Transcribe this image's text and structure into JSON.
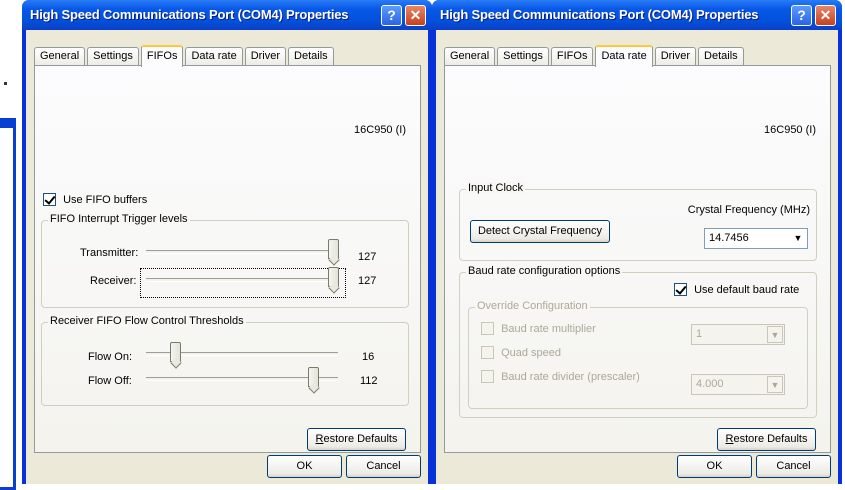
{
  "left_window": {
    "title": "High Speed Communications Port (COM4) Properties",
    "tabs": [
      "General",
      "Settings",
      "FIFOs",
      "Data rate",
      "Driver",
      "Details"
    ],
    "active_tab": "FIFOs",
    "chip": "16C950 (I)",
    "use_fifo_label": "Use FIFO buffers",
    "use_fifo_checked": true,
    "trigger_group": {
      "title": "FIFO Interrupt Trigger levels",
      "transmitter_label": "Transmitter:",
      "transmitter_value": "127",
      "receiver_label": "Receiver:",
      "receiver_value": "127"
    },
    "flow_group": {
      "title": "Receiver FIFO Flow Control Thresholds",
      "flow_on_label": "Flow On:",
      "flow_on_value": "16",
      "flow_off_label": "Flow Off:",
      "flow_off_value": "112"
    },
    "restore_prefix": "R",
    "restore_rest": "estore Defaults",
    "ok_label": "OK",
    "cancel_label": "Cancel"
  },
  "right_window": {
    "title": "High Speed Communications Port (COM4) Properties",
    "tabs": [
      "General",
      "Settings",
      "FIFOs",
      "Data rate",
      "Driver",
      "Details"
    ],
    "active_tab": "Data rate",
    "chip": "16C950 (I)",
    "input_clock": {
      "title": "Input Clock",
      "crystal_label": "Crystal Frequency (MHz)",
      "detect_button": "Detect Crystal Frequency",
      "crystal_value": "14.7456"
    },
    "baud": {
      "title": "Baud rate configuration options",
      "use_default_label": "Use default baud rate",
      "use_default_checked": true,
      "override_title": "Override Configuration",
      "multiplier_label": "Baud rate multiplier",
      "multiplier_value": "1",
      "quad_label": "Quad speed",
      "divider_label": "Baud rate divider (prescaler)",
      "divider_value": "4.000"
    },
    "restore_prefix": "R",
    "restore_rest": "estore Defaults",
    "ok_label": "OK",
    "cancel_label": "Cancel"
  },
  "icons": {
    "help": "?",
    "close": "✕",
    "dropdown": "▼"
  }
}
